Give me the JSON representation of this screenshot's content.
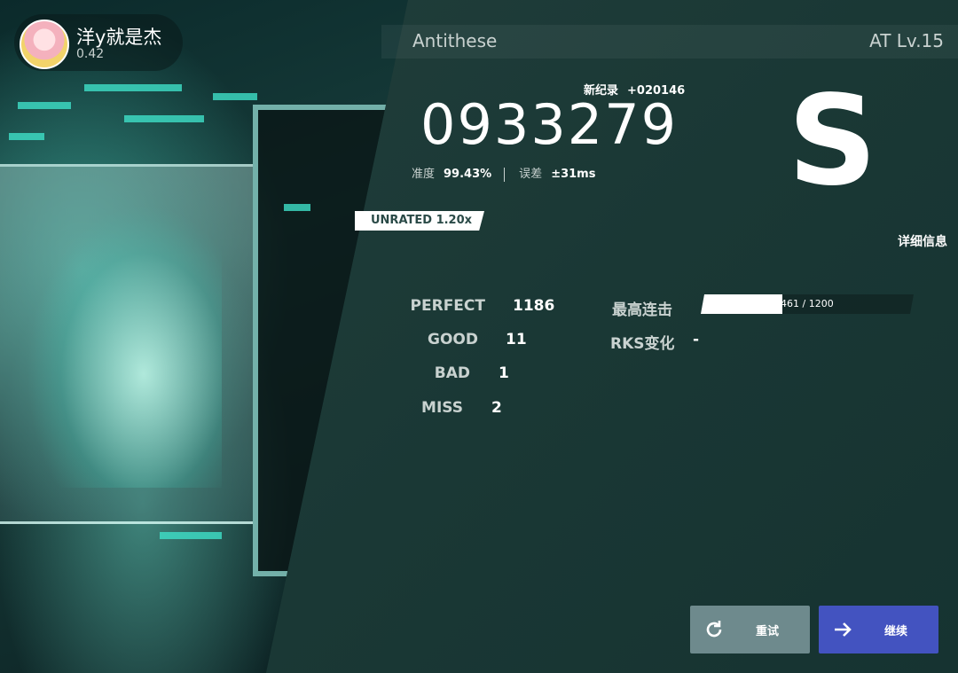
{
  "player": {
    "name": "洋y就是杰",
    "rks": "0.42"
  },
  "song": {
    "title": "Antithese",
    "difficulty": "AT Lv.15"
  },
  "result": {
    "new_record_label": "新纪录",
    "new_record_delta": "+020146",
    "score": "0933279",
    "accuracy_label": "准度",
    "accuracy": "99.43%",
    "error_label": "误差",
    "error": "±31ms",
    "grade": "S",
    "speed_badge": "UNRATED 1.20x",
    "details_label": "详细信息"
  },
  "judgements": {
    "perfect_label": "PERFECT",
    "perfect": "1186",
    "good_label": "GOOD",
    "good": "11",
    "bad_label": "BAD",
    "bad": "1",
    "miss_label": "MISS",
    "miss": "2"
  },
  "combo": {
    "label": "最高连击",
    "text": "461 / 1200",
    "max": 461,
    "total": 1200,
    "fill_fraction": 0.384
  },
  "rks_change": {
    "label": "RKS变化",
    "value": "-"
  },
  "buttons": {
    "retry": "重试",
    "continue": "继续"
  },
  "colors": {
    "continue_button": "#4353c0",
    "retry_button": "#6e8a8d",
    "accent": "#3ee0c8"
  },
  "icons": {
    "retry": "refresh-icon",
    "continue": "arrow-right-icon"
  }
}
